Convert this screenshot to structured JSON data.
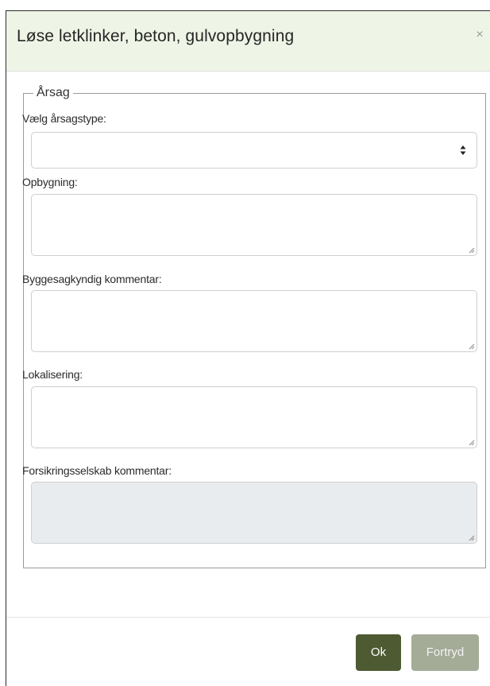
{
  "dialog": {
    "title": "Løse letklinker, beton, gulvopbygning",
    "close_icon": "close-icon"
  },
  "form": {
    "legend": "Årsag",
    "cause_type_label": "Vælg årsagstype:",
    "cause_type_value": "",
    "construction_label": "Opbygning:",
    "construction_value": "",
    "expert_comment_label": "Byggesagkyndig kommentar:",
    "expert_comment_value": "",
    "location_label": "Lokalisering:",
    "location_value": "",
    "insurer_comment_label": "Forsikringsselskab kommentar:",
    "insurer_comment_value": ""
  },
  "footer": {
    "ok_label": "Ok",
    "cancel_label": "Fortryd"
  },
  "colors": {
    "header_bg": "#eff5e6",
    "ok_button": "#4e5a32",
    "cancel_button": "#a4ab97",
    "disabled_field": "#e9ecef"
  }
}
